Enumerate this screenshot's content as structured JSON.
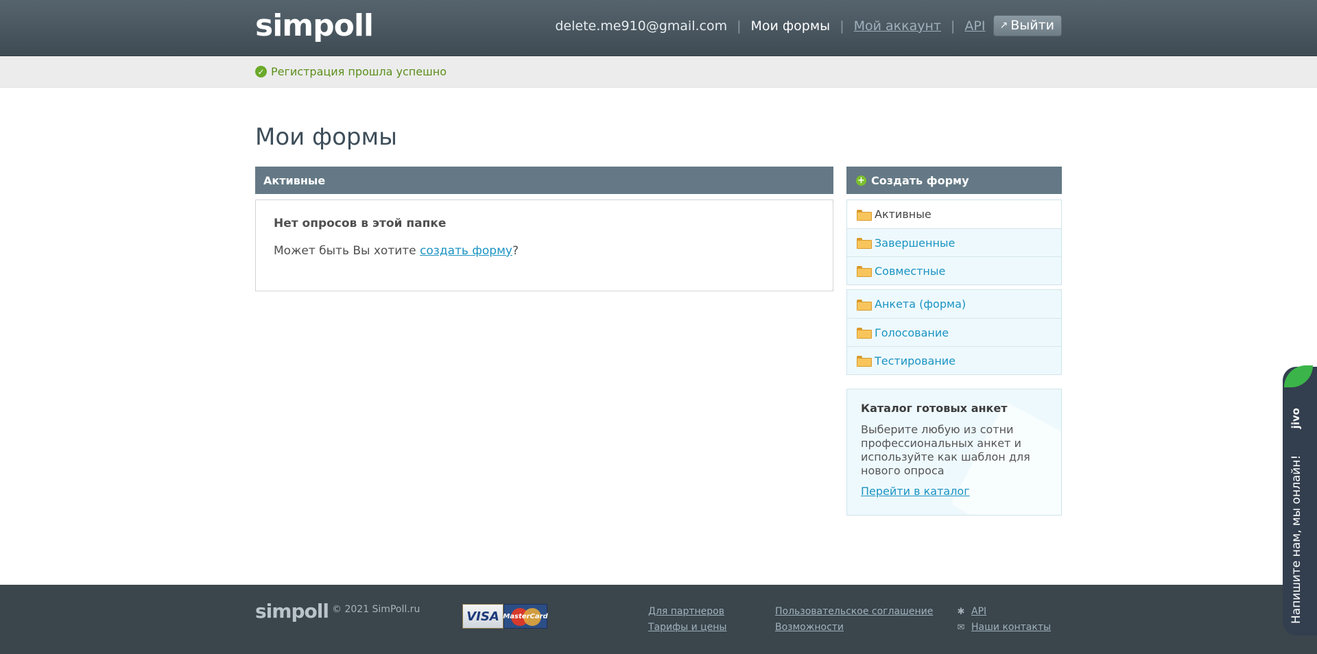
{
  "header": {
    "logo": "simpoll",
    "email": "delete.me910@gmail.com",
    "nav_forms": "Мои формы",
    "nav_account": "Мой аккаунт",
    "nav_api": "API",
    "logout": "Выйти",
    "separator": "|"
  },
  "notice": {
    "message": "Регистрация прошла успешно"
  },
  "page": {
    "title": "Мои формы"
  },
  "left_panel": {
    "header": "Активные",
    "empty_title": "Нет опросов в этой папке",
    "empty_text_prefix": "Может быть Вы хотите ",
    "empty_link": "создать форму",
    "empty_text_suffix": "?"
  },
  "sidebar": {
    "create_button": "Создать форму",
    "folders_status": [
      {
        "label": "Активные",
        "current": true
      },
      {
        "label": "Завершенные",
        "current": false
      },
      {
        "label": "Совместные",
        "current": false
      }
    ],
    "folders_type": [
      {
        "label": "Анкета (форма)"
      },
      {
        "label": "Голосование"
      },
      {
        "label": "Тестирование"
      }
    ],
    "catalog": {
      "title": "Каталог готовых анкет",
      "text": "Выберите любую из сотни профессиональных анкет и используйте как шаблон для нового опроса",
      "link": "Перейти в каталог"
    }
  },
  "footer": {
    "logo": "simpoll",
    "copyright": "© 2021 SimPoll.ru",
    "visa": "VISA",
    "mastercard": "MasterCard",
    "links_col1": [
      "Для партнеров",
      "Тарифы и цены"
    ],
    "links_col2": [
      "Пользовательское соглашение",
      "Возможности"
    ],
    "api": "API",
    "contacts": "Наши контакты"
  },
  "jivo": {
    "brand": "jivo",
    "cta": "Напишите нам, мы онлайн!"
  },
  "colors": {
    "header_bg": "#4b5861",
    "panel_head": "#647985",
    "link": "#1a93c2",
    "success": "#5b8f1b",
    "footer_bg": "#3b454c",
    "jivo_bg": "#333f4f"
  }
}
